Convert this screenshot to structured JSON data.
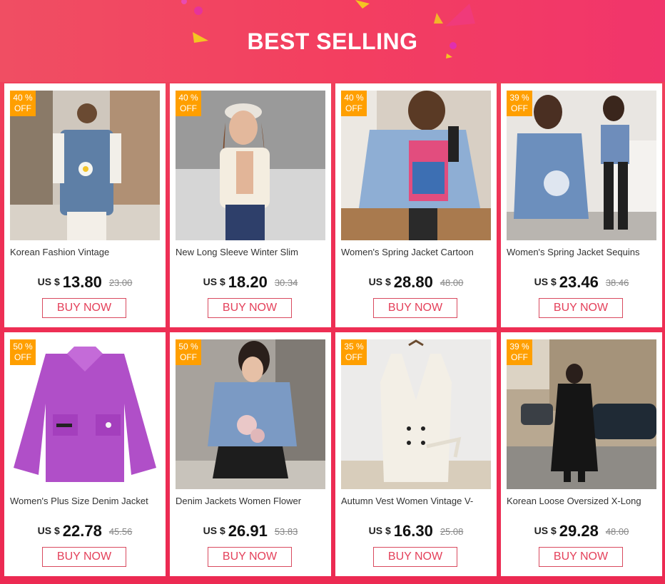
{
  "banner": {
    "title": "BEST SELLING"
  },
  "currency": "US $",
  "buy_label": "BUY NOW",
  "products": [
    {
      "discount": "40 %",
      "off": "OFF",
      "name": "Korean Fashion Vintage",
      "price": "13.80",
      "original_price": "23.00",
      "image": "denim-vest-back-photo"
    },
    {
      "discount": "40 %",
      "off": "OFF",
      "name": "New Long Sleeve Winter Slim",
      "price": "18.20",
      "original_price": "30.34",
      "image": "white-jacket-photo"
    },
    {
      "discount": "40 %",
      "off": "OFF",
      "name": "Women's Spring Jacket Cartoon",
      "price": "28.80",
      "original_price": "48.00",
      "image": "cartoon-denim-jacket-photo"
    },
    {
      "discount": "39 %",
      "off": "OFF",
      "name": "Women's Spring Jacket Sequins",
      "price": "23.46",
      "original_price": "38.46",
      "image": "sequin-denim-jacket-photo"
    },
    {
      "discount": "50 %",
      "off": "OFF",
      "name": "Women's Plus Size Denim Jacket",
      "price": "22.78",
      "original_price": "45.56",
      "image": "purple-jacket-photo"
    },
    {
      "discount": "50 %",
      "off": "OFF",
      "name": "Denim Jackets Women Flower",
      "price": "26.91",
      "original_price": "53.83",
      "image": "flower-denim-jacket-photo"
    },
    {
      "discount": "35 %",
      "off": "OFF",
      "name": "Autumn Vest Women Vintage V-",
      "price": "16.30",
      "original_price": "25.08",
      "image": "white-vest-photo"
    },
    {
      "discount": "39 %",
      "off": "OFF",
      "name": "Korean Loose Oversized X-Long",
      "price": "29.28",
      "original_price": "48.00",
      "image": "black-long-coat-photo"
    }
  ],
  "colors": {
    "accent": "#ee2f55",
    "badge": "#ff9f00",
    "buy_border": "#d94a5f"
  }
}
